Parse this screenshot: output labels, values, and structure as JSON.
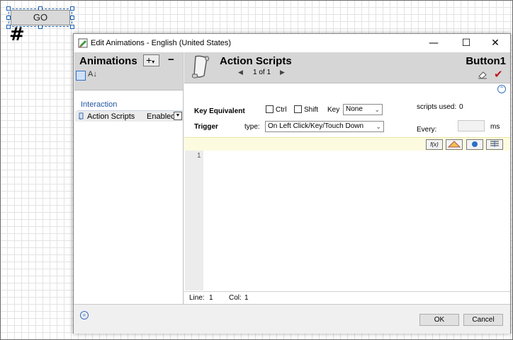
{
  "canvas": {
    "go_button_label": "GO",
    "hash_glyph": "#"
  },
  "dialog": {
    "title": "Edit Animations - English (United States)",
    "window_controls": {
      "minimize": "—",
      "maximize": "☐",
      "close": "✕"
    }
  },
  "left_panel": {
    "title": "Animations",
    "add_label": "+",
    "remove_label": "−",
    "sort_label": "A↓",
    "group": "Interaction",
    "items": [
      {
        "name": "Action Scripts",
        "status": "Enabled"
      }
    ]
  },
  "right_header": {
    "title": "Action Scripts",
    "page_info": "1 of 1",
    "object_name": "Button1"
  },
  "key_equivalent": {
    "label": "Key Equivalent",
    "ctrl_label": "Ctrl",
    "shift_label": "Shift",
    "key_label": "Key",
    "key_value": "None",
    "scripts_used_label": "scripts used:",
    "scripts_used_value": "0"
  },
  "trigger": {
    "label": "Trigger",
    "type_label": "type:",
    "type_value": "On Left Click/Key/Touch Down",
    "every_label": "Every:",
    "every_unit": "ms"
  },
  "editor": {
    "line_number": "1",
    "status_line_label": "Line:",
    "status_line_value": "1",
    "status_col_label": "Col:",
    "status_col_value": "1"
  },
  "buttons": {
    "ok": "OK",
    "cancel": "Cancel"
  },
  "colors": {
    "accent": "#1a5fb4",
    "check": "#c0171c",
    "toolbar_strip": "#fdfbdf"
  }
}
